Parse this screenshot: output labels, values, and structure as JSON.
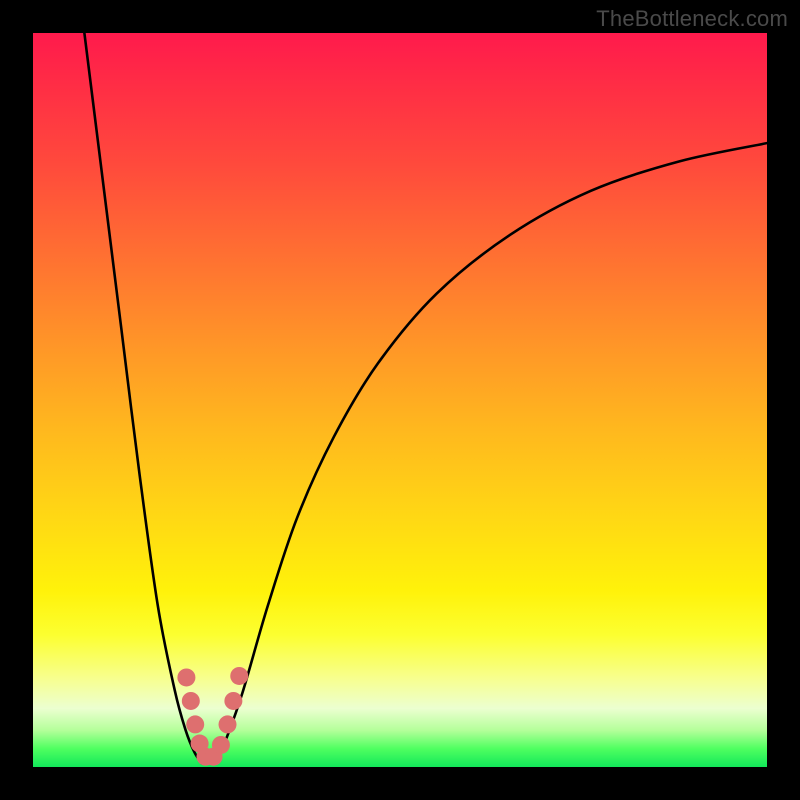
{
  "watermark": "TheBottleneck.com",
  "chart_data": {
    "type": "line",
    "title": "",
    "xlabel": "",
    "ylabel": "",
    "xlim": [
      0,
      100
    ],
    "ylim": [
      0,
      100
    ],
    "grid": false,
    "legend": false,
    "series": [
      {
        "name": "left-branch",
        "x": [
          7.0,
          10.0,
          12.0,
          14.5,
          17.0,
          19.3,
          20.8,
          22.0,
          23.0
        ],
        "values": [
          100.0,
          76.0,
          60.0,
          40.0,
          22.0,
          10.5,
          5.0,
          2.0,
          0.5
        ],
        "stroke": "#000000",
        "stroke_width": 2.6
      },
      {
        "name": "right-branch",
        "x": [
          25.0,
          26.2,
          28.5,
          32.0,
          36.0,
          41.0,
          47.0,
          55.0,
          65.0,
          76.0,
          88.0,
          100.0
        ],
        "values": [
          0.5,
          3.5,
          10.0,
          22.0,
          34.0,
          45.0,
          55.0,
          64.5,
          72.5,
          78.5,
          82.5,
          85.0
        ],
        "stroke": "#000000",
        "stroke_width": 2.6
      }
    ],
    "markers": [
      {
        "name": "pink-dot",
        "x": 20.9,
        "y": 12.2,
        "r": 9,
        "fill": "#de6f6f"
      },
      {
        "name": "pink-dot",
        "x": 21.5,
        "y": 9.0,
        "r": 9,
        "fill": "#de6f6f"
      },
      {
        "name": "pink-dot",
        "x": 22.1,
        "y": 5.8,
        "r": 9,
        "fill": "#de6f6f"
      },
      {
        "name": "pink-dot",
        "x": 22.7,
        "y": 3.2,
        "r": 9,
        "fill": "#de6f6f"
      },
      {
        "name": "pink-dot",
        "x": 23.5,
        "y": 1.4,
        "r": 9,
        "fill": "#de6f6f"
      },
      {
        "name": "pink-dot",
        "x": 24.6,
        "y": 1.4,
        "r": 9,
        "fill": "#de6f6f"
      },
      {
        "name": "pink-dot",
        "x": 25.6,
        "y": 3.0,
        "r": 9,
        "fill": "#de6f6f"
      },
      {
        "name": "pink-dot",
        "x": 26.5,
        "y": 5.8,
        "r": 9,
        "fill": "#de6f6f"
      },
      {
        "name": "pink-dot",
        "x": 27.3,
        "y": 9.0,
        "r": 9,
        "fill": "#de6f6f"
      },
      {
        "name": "pink-dot",
        "x": 28.1,
        "y": 12.4,
        "r": 9,
        "fill": "#de6f6f"
      }
    ],
    "background_gradient_stops": [
      {
        "pct": 0,
        "color": "#ff1a4c"
      },
      {
        "pct": 50,
        "color": "#ffb81e"
      },
      {
        "pct": 80,
        "color": "#fcff30"
      },
      {
        "pct": 100,
        "color": "#12e85a"
      }
    ]
  }
}
